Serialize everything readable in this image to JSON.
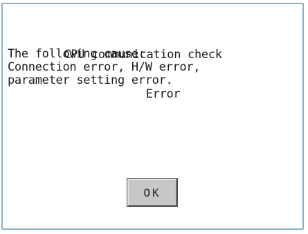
{
  "dialog": {
    "title_line1": "CPU communication check",
    "title_line2": "Error",
    "message_lines": [
      "The following cause:",
      "Connection error, H/W error,",
      "parameter setting error."
    ],
    "ok_label": "OK"
  },
  "colors": {
    "border": "#8fb0c2",
    "button_face": "#c7c7c7",
    "text": "#1a1a1a"
  }
}
